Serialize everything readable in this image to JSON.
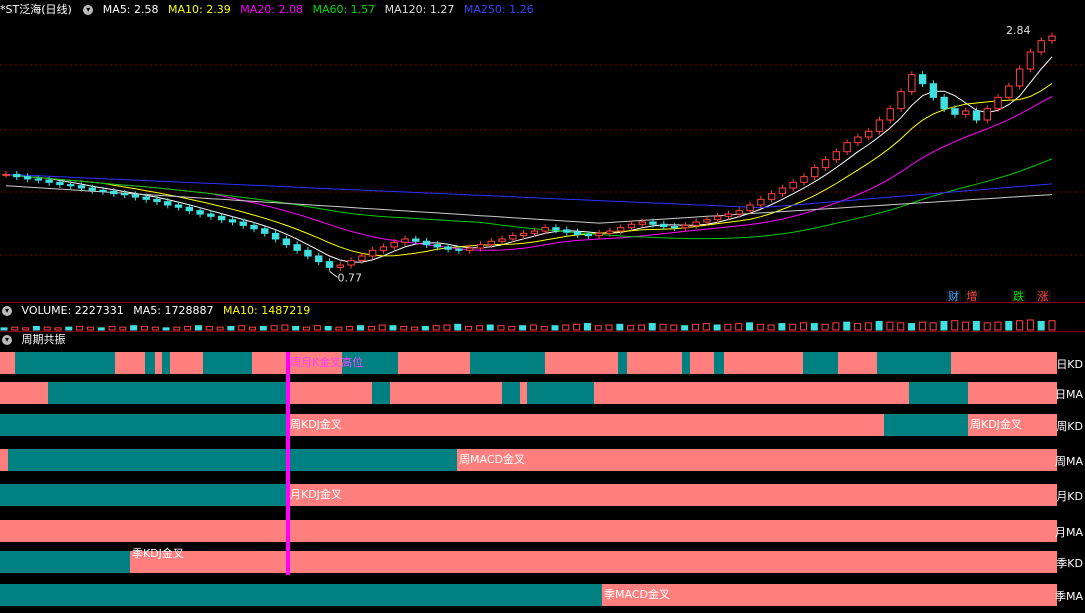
{
  "window": {
    "stock_title": "*ST泛海(日线)"
  },
  "price_header": {
    "ma5": "MA5: 2.58",
    "ma10": "MA10: 2.39",
    "ma20": "MA20: 2.08",
    "ma60": "MA60: 1.57",
    "ma120": "MA120: 1.27",
    "ma250": "MA250: 1.26"
  },
  "volume_header": {
    "volume": "VOLUME: 2227331",
    "ma5": "MA5: 1728887",
    "ma10": "MA10: 1487219"
  },
  "resonance_header": {
    "title": "周期共振"
  },
  "status_tags": {
    "cai": "财",
    "zeng": "增",
    "die": "跌",
    "zhang": "涨"
  },
  "chart_data": [
    {
      "type": "candlestick",
      "title": "*ST泛海(日线)",
      "ylim": [
        0.6,
        3.0
      ],
      "annotations": {
        "high": "2.84",
        "low": "0.77"
      },
      "series_colors": {
        "ma5": "#ffffff",
        "ma10": "#ffff00",
        "ma20": "#ff00ff",
        "ma60": "#00cc00",
        "ma120": "#cccccc",
        "ma250": "#3030ff",
        "up": "#ff4040",
        "down": "#40e0e0"
      },
      "ohlc_closes": [
        1.62,
        1.6,
        1.58,
        1.57,
        1.55,
        1.53,
        1.52,
        1.5,
        1.48,
        1.47,
        1.45,
        1.44,
        1.42,
        1.4,
        1.38,
        1.35,
        1.33,
        1.3,
        1.27,
        1.25,
        1.22,
        1.2,
        1.17,
        1.14,
        1.1,
        1.05,
        1.0,
        0.95,
        0.9,
        0.85,
        0.8,
        0.82,
        0.86,
        0.9,
        0.95,
        0.98,
        1.02,
        1.05,
        1.03,
        1.0,
        0.98,
        0.96,
        0.95,
        0.97,
        1.0,
        1.03,
        1.05,
        1.08,
        1.1,
        1.12,
        1.15,
        1.13,
        1.11,
        1.09,
        1.08,
        1.1,
        1.12,
        1.15,
        1.18,
        1.2,
        1.18,
        1.16,
        1.15,
        1.17,
        1.2,
        1.22,
        1.25,
        1.27,
        1.3,
        1.35,
        1.4,
        1.45,
        1.5,
        1.55,
        1.6,
        1.68,
        1.75,
        1.82,
        1.9,
        1.95,
        2.0,
        2.1,
        2.2,
        2.35,
        2.5,
        2.42,
        2.3,
        2.2,
        2.15,
        2.18,
        2.1,
        2.2,
        2.3,
        2.4,
        2.55,
        2.7,
        2.8,
        2.84
      ],
      "ma": {
        "ma5": "2.58",
        "ma10": "2.39",
        "ma20": "2.08",
        "ma60": "1.57",
        "ma120": "1.27",
        "ma250": "1.26"
      }
    },
    {
      "type": "bar",
      "title": "VOLUME",
      "values": [
        3,
        4,
        3,
        5,
        4,
        3,
        4,
        5,
        4,
        3,
        5,
        4,
        6,
        5,
        4,
        3,
        4,
        5,
        6,
        5,
        4,
        5,
        6,
        4,
        5,
        6,
        7,
        5,
        4,
        6,
        5,
        4,
        5,
        6,
        5,
        7,
        6,
        5,
        4,
        5,
        6,
        7,
        8,
        5,
        6,
        7,
        6,
        5,
        6,
        7,
        5,
        6,
        7,
        8,
        9,
        6,
        7,
        8,
        6,
        7,
        9,
        8,
        7,
        6,
        8,
        9,
        7,
        8,
        9,
        10,
        8,
        7,
        9,
        8,
        10,
        9,
        8,
        10,
        11,
        9,
        10,
        12,
        11,
        10,
        9,
        11,
        10,
        12,
        13,
        11,
        12,
        10,
        11,
        12,
        13,
        14,
        12,
        13
      ]
    },
    {
      "type": "table",
      "title": "周期共振",
      "rows": [
        {
          "label": "日KD",
          "segments": [
            [
              0,
              15,
              "r"
            ],
            [
              15,
              115,
              "t"
            ],
            [
              115,
              145,
              "r"
            ],
            [
              145,
              155,
              "t"
            ],
            [
              155,
              162,
              "r"
            ],
            [
              162,
              170,
              "t"
            ],
            [
              170,
              203,
              "r"
            ],
            [
              203,
              252,
              "t"
            ],
            [
              252,
              288,
              "r"
            ],
            [
              288,
              342,
              "r"
            ],
            [
              342,
              398,
              "t"
            ],
            [
              398,
              470,
              "r"
            ],
            [
              470,
              545,
              "t"
            ],
            [
              545,
              618,
              "r"
            ],
            [
              618,
              627,
              "t"
            ],
            [
              627,
              682,
              "r"
            ],
            [
              682,
              690,
              "t"
            ],
            [
              690,
              714,
              "r"
            ],
            [
              714,
              724,
              "t"
            ],
            [
              724,
              803,
              "r"
            ],
            [
              803,
              838,
              "t"
            ],
            [
              838,
              877,
              "r"
            ],
            [
              877,
              951,
              "t"
            ],
            [
              951,
              1057,
              "r"
            ]
          ],
          "annotations": [
            {
              "x": 290,
              "text": "周月K金叉高位",
              "color": "#ff40ff"
            }
          ]
        },
        {
          "label": "日MA",
          "segments": [
            [
              0,
              48,
              "r"
            ],
            [
              48,
              288,
              "t"
            ],
            [
              288,
              372,
              "r"
            ],
            [
              372,
              390,
              "t"
            ],
            [
              390,
              502,
              "r"
            ],
            [
              502,
              520,
              "t"
            ],
            [
              520,
              527,
              "r"
            ],
            [
              527,
              594,
              "t"
            ],
            [
              594,
              909,
              "r"
            ],
            [
              909,
              968,
              "t"
            ],
            [
              968,
              1057,
              "r"
            ]
          ],
          "annotations": []
        },
        {
          "label": "周KD",
          "segments": [
            [
              0,
              288,
              "t"
            ],
            [
              288,
              884,
              "r"
            ],
            [
              884,
              968,
              "t"
            ],
            [
              968,
              1057,
              "r"
            ]
          ],
          "annotations": [
            {
              "x": 290,
              "text": "周KDJ金叉",
              "color": "#ffffff"
            },
            {
              "x": 970,
              "text": "周KDJ金叉",
              "color": "#ffffff"
            }
          ]
        },
        {
          "label": "周MA",
          "segments": [
            [
              0,
              8,
              "r"
            ],
            [
              8,
              457,
              "t"
            ],
            [
              457,
              1057,
              "r"
            ]
          ],
          "annotations": [
            {
              "x": 459,
              "text": "周MACD金叉",
              "color": "#ffffff"
            }
          ]
        },
        {
          "label": "月KD",
          "segments": [
            [
              0,
              288,
              "t"
            ],
            [
              288,
              1057,
              "r"
            ]
          ],
          "annotations": [
            {
              "x": 290,
              "text": "月KDJ金叉",
              "color": "#ffffff"
            }
          ]
        },
        {
          "label": "月MA",
          "segments": [
            [
              0,
              1057,
              "r"
            ]
          ],
          "annotations": []
        },
        {
          "label": "季KD",
          "segments": [
            [
              0,
              130,
              "t"
            ],
            [
              130,
              1057,
              "r"
            ]
          ],
          "annotations": [
            {
              "x": 132,
              "text": "季KDJ金叉",
              "color": "#ffffff"
            }
          ]
        },
        {
          "label": "季MA",
          "segments": [
            [
              0,
              602,
              "t"
            ],
            [
              602,
              1057,
              "r"
            ]
          ],
          "annotations": [
            {
              "x": 604,
              "text": "季MACD金叉",
              "color": "#ffffff"
            }
          ]
        }
      ],
      "colors": {
        "r": "#ff7f7f",
        "t": "#008080",
        "marker": "#ff00ff"
      }
    }
  ]
}
